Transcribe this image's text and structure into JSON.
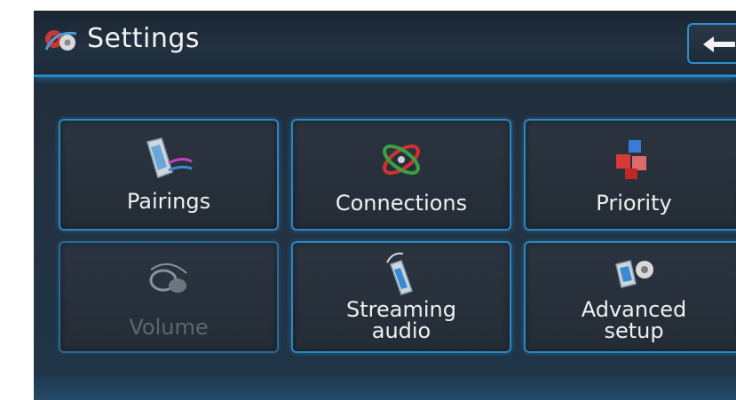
{
  "header": {
    "title": "Settings",
    "logo_icon": "gear-settings-icon",
    "back_icon": "back-arrow-icon"
  },
  "tiles": [
    {
      "label": "Pairings",
      "icon": "phone-pairing-icon",
      "enabled": true
    },
    {
      "label": "Connections",
      "icon": "connections-orbit-icon",
      "enabled": true
    },
    {
      "label": "Priority",
      "icon": "priority-blocks-icon",
      "enabled": true
    },
    {
      "label": "Volume",
      "icon": "volume-speaker-icon",
      "enabled": false
    },
    {
      "label_line1": "Streaming",
      "label_line2": "audio",
      "icon": "streaming-phone-icon",
      "enabled": true
    },
    {
      "label_line1": "Advanced",
      "label_line2": "setup",
      "icon": "advanced-setup-icon",
      "enabled": true
    }
  ],
  "colors": {
    "accent": "#2a8ac8",
    "background": "#1e2a36",
    "text": "#f0f0f0",
    "disabled_text": "#5e6670"
  }
}
